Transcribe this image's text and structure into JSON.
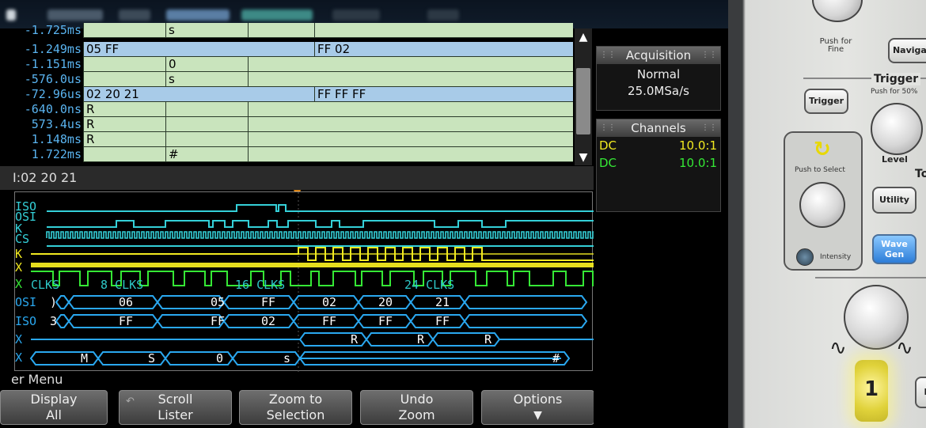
{
  "lister": {
    "rows": [
      {
        "time": "-1.725ms",
        "c1": "",
        "c2": "s",
        "c3": "",
        "highlight": false
      },
      {
        "time": "-1.249ms",
        "c1": "05 FF",
        "c2": "",
        "c3": "FF 02",
        "highlight": true
      },
      {
        "time": "-1.151ms",
        "c1": "",
        "c2": "0",
        "c3": "",
        "highlight": false
      },
      {
        "time": "-576.0us",
        "c1": "",
        "c2": "s",
        "c3": "",
        "highlight": false
      },
      {
        "time": "-72.96us",
        "c1": "02 20 21",
        "c2": "",
        "c3": "FF FF FF",
        "highlight": true
      },
      {
        "time": "-640.0ns",
        "c1": "R",
        "c2": "",
        "c3": "",
        "highlight": false
      },
      {
        "time": "573.4us",
        "c1": "R",
        "c2": "",
        "c3": "",
        "highlight": false
      },
      {
        "time": "1.148ms",
        "c1": "R",
        "c2": "",
        "c3": "",
        "highlight": false
      },
      {
        "time": "1.722ms",
        "c1": "",
        "c2": "#",
        "c3": "",
        "highlight": false
      }
    ]
  },
  "decode_line": "I:02 20 21",
  "waveform": {
    "labels": [
      "ISO",
      "OSI",
      "K",
      "CS",
      "K",
      "X",
      "X",
      "OSI",
      "ISO",
      "X",
      "X"
    ],
    "clk_labels": [
      "CLKS",
      "8 CLKS",
      "16 CLKS",
      "24 CLKS"
    ],
    "mosi_bytes": [
      "06",
      "05",
      "FF",
      "02",
      "20",
      "21"
    ],
    "miso_bytes": [
      "FF",
      "FF",
      "02",
      "FF",
      "FF",
      "FF"
    ],
    "mosi_prefix": ")",
    "miso_prefix": "3",
    "rx_bytes": [
      "R",
      "R",
      "R"
    ],
    "tx_bytes": [
      "M",
      "S",
      "0",
      "s",
      "#"
    ]
  },
  "acquisition": {
    "title": "Acquisition",
    "mode": "Normal",
    "rate": "25.0MSa/s"
  },
  "channels": {
    "title": "Channels",
    "items": [
      {
        "coupling": "DC",
        "scale": "10.0:1",
        "color": "#f2ea20"
      },
      {
        "coupling": "DC",
        "scale": "10.0:1",
        "color": "#35e835"
      }
    ]
  },
  "menu": {
    "title": "er Menu",
    "softkeys": [
      {
        "line1": "Display",
        "line2": "All"
      },
      {
        "line1": "Scroll",
        "line2": "Lister"
      },
      {
        "line1": "Zoom to",
        "line2": "Selection"
      },
      {
        "line1": "Undo",
        "line2": "Zoom"
      },
      {
        "line1": "Options",
        "line2": ""
      }
    ]
  },
  "panel": {
    "push_fine": "Push for Fine",
    "navigate": "Navigat",
    "trigger_heading": "Trigger",
    "push50": "Push for 50%",
    "trigger_btn": "Trigger",
    "level": "Level",
    "push_select": "Push to Select",
    "utility": "Utility",
    "intensity": "Intensity",
    "wavegen_l1": "Wave",
    "wavegen_l2": "Gen",
    "to_partial": "To",
    "channel1": "1",
    "l_partial": "L"
  },
  "colors": {
    "ch1": "#f2ea20",
    "ch2": "#35e835",
    "serial": "#2aa8f0",
    "lister_green": "#c9e4bd",
    "lister_blue": "#a8cbe8"
  }
}
